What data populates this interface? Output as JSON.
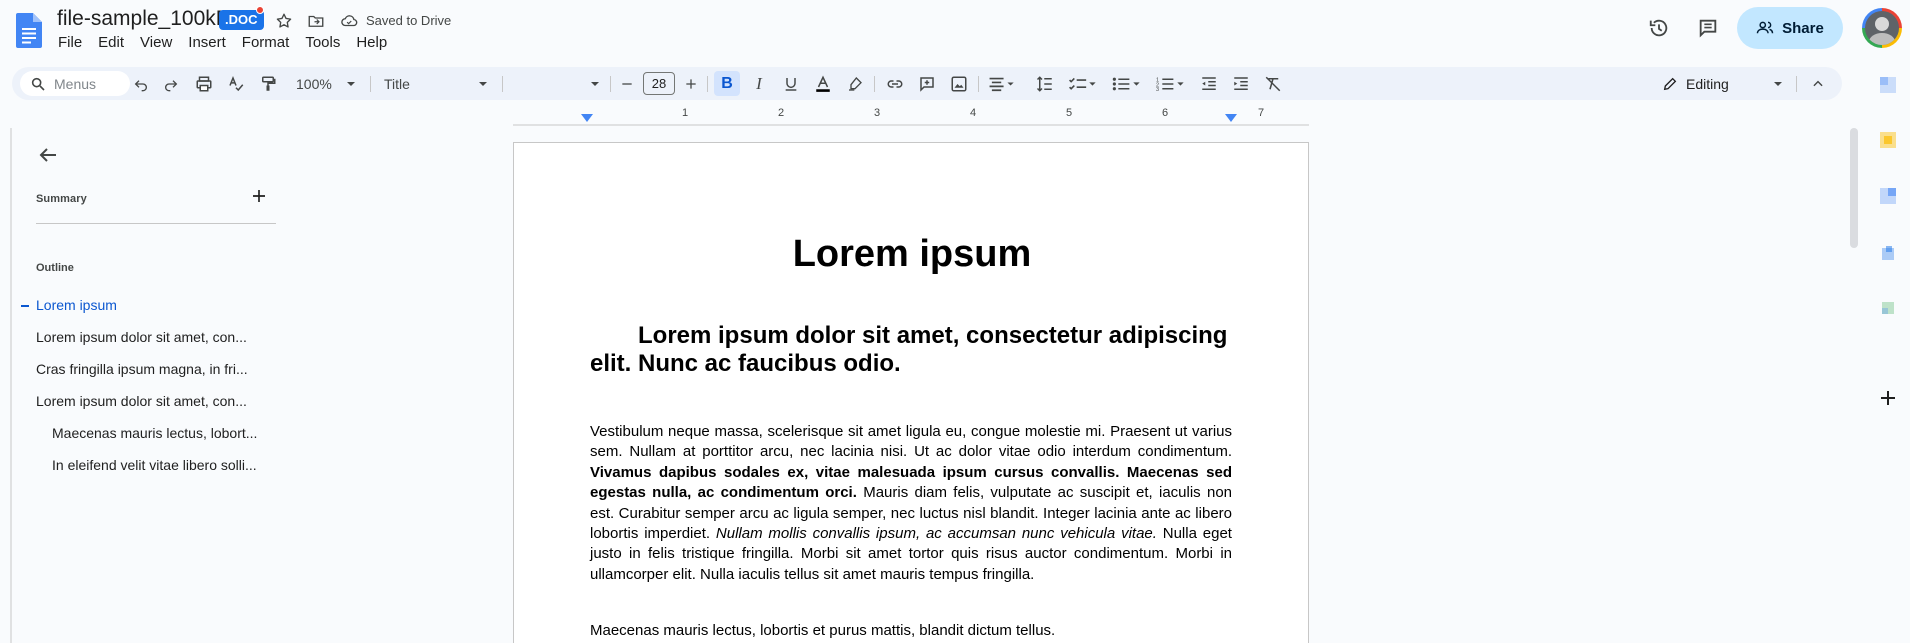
{
  "title_bar": {
    "doc_name": "file-sample_100kB",
    "badge": ".DOC",
    "status": "Saved to Drive",
    "share_label": "Share"
  },
  "menu": [
    "File",
    "Edit",
    "View",
    "Insert",
    "Format",
    "Tools",
    "Help"
  ],
  "toolbar": {
    "search_placeholder": "Menus",
    "zoom": "100%",
    "style": "Title",
    "font": "",
    "font_size": "28",
    "mode": "Editing"
  },
  "ruler": {
    "numbers": [
      "1",
      "2",
      "3",
      "4",
      "5",
      "6",
      "7"
    ]
  },
  "sidebar": {
    "summary_label": "Summary",
    "outline_label": "Outline",
    "items": [
      {
        "label": "Lorem ipsum",
        "active": true,
        "level": 1
      },
      {
        "label": "Lorem ipsum dolor sit amet, con...",
        "active": false,
        "level": 1
      },
      {
        "label": "Cras fringilla ipsum magna, in fri...",
        "active": false,
        "level": 1
      },
      {
        "label": "Lorem ipsum dolor sit amet, con...",
        "active": false,
        "level": 1
      },
      {
        "label": "Maecenas mauris lectus, lobort...",
        "active": false,
        "level": 2
      },
      {
        "label": "In eleifend velit vitae libero solli...",
        "active": false,
        "level": 2
      }
    ]
  },
  "document": {
    "title": "Lorem ipsum",
    "heading": "Lorem ipsum dolor sit amet, consectetur adipiscing elit. Nunc ac faucibus odio.",
    "para1": {
      "a": "Vestibulum neque massa, scelerisque sit amet ligula eu, congue molestie mi. Praesent ut varius sem. Nullam at porttitor arcu, nec lacinia nisi. Ut ac dolor vitae odio interdum condimentum. ",
      "bold": "Vivamus dapibus sodales ex, vitae malesuada ipsum cursus convallis. Maecenas sed egestas nulla, ac condimentum orci.",
      "b": " Mauris diam felis, vulputate ac suscipit et, iaculis non est. Curabitur semper arcu ac ligula semper, nec luctus nisl blandit. Integer lacinia ante ac libero lobortis imperdiet. ",
      "italic": "Nullam mollis convallis ipsum, ac accumsan nunc vehicula vitae.",
      "c": " Nulla eget justo in felis tristique fringilla. Morbi sit amet tortor quis risus auctor condimentum. Morbi in ullamcorper elit. Nulla iaculis tellus sit amet mauris tempus fringilla."
    },
    "para2": "Maecenas mauris lectus, lobortis et purus mattis, blandit dictum tellus."
  },
  "colors": {
    "accent": "#1a73e8",
    "share_bg": "#c2e7ff",
    "toolbar_bg": "#edf2fa",
    "active_outline": "#0b57d0"
  }
}
